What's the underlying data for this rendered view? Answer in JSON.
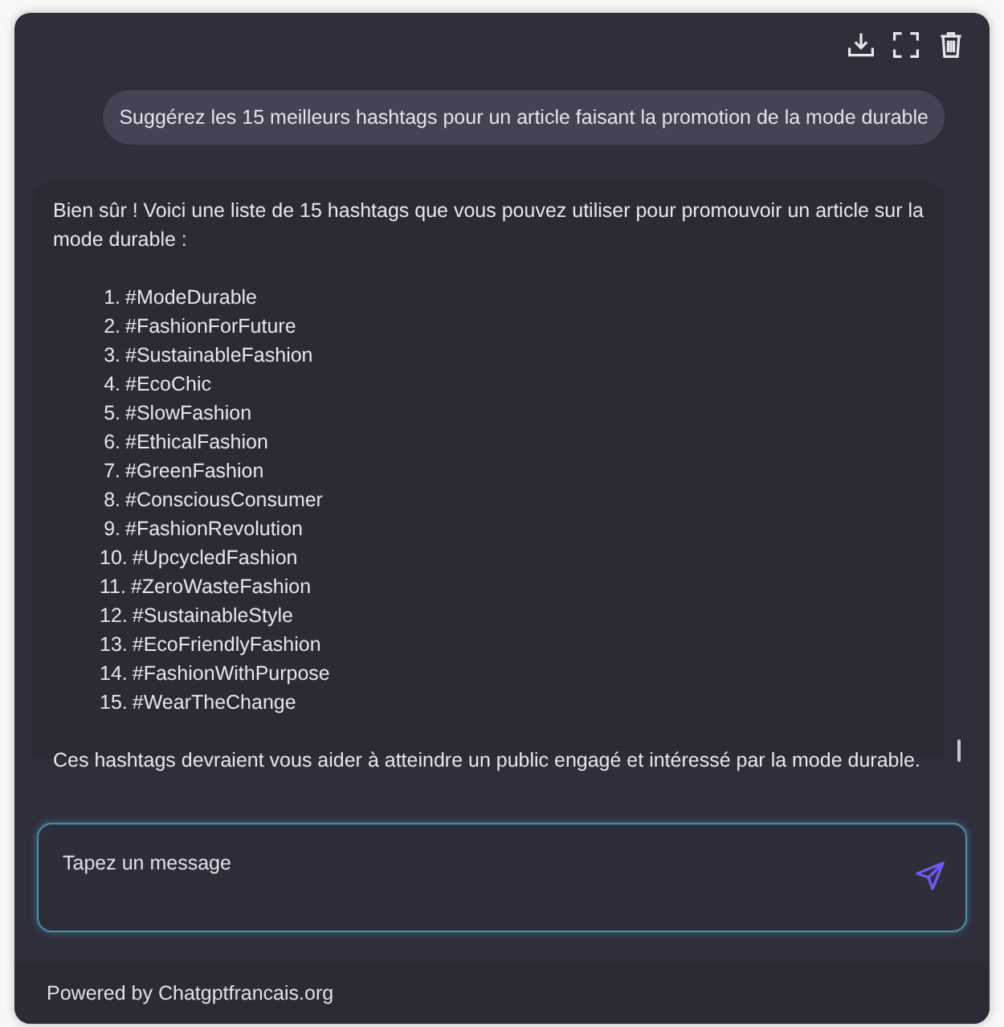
{
  "toolbar": {
    "buttons": [
      {
        "kind": "download"
      },
      {
        "kind": "fullscreen"
      },
      {
        "kind": "delete"
      }
    ]
  },
  "messages": [
    {
      "kind": "user",
      "text": "Suggérez les 15 meilleurs hashtags pour un article faisant la promotion de la mode durable"
    },
    {
      "kind": "assistant",
      "intro": "Bien sûr ! Voici une liste de 15 hashtags que vous pouvez utiliser pour promouvoir un article sur la mode durable :",
      "list": [
        {
          "number": "1.",
          "text": "#ModeDurable"
        },
        {
          "number": "2.",
          "text": "#FashionForFuture"
        },
        {
          "number": "3.",
          "text": "#SustainableFashion"
        },
        {
          "number": "4.",
          "text": "#EcoChic"
        },
        {
          "number": "5.",
          "text": "#SlowFashion"
        },
        {
          "number": "6.",
          "text": "#EthicalFashion"
        },
        {
          "number": "7.",
          "text": "#GreenFashion"
        },
        {
          "number": "8.",
          "text": "#ConsciousConsumer"
        },
        {
          "number": "9.",
          "text": "#FashionRevolution"
        },
        {
          "number": "10.",
          "text": "#UpcycledFashion"
        },
        {
          "number": "11.",
          "text": "#ZeroWasteFashion"
        },
        {
          "number": "12.",
          "text": "#SustainableStyle"
        },
        {
          "number": "13.",
          "text": "#EcoFriendlyFashion"
        },
        {
          "number": "14.",
          "text": "#FashionWithPurpose"
        },
        {
          "number": "15.",
          "text": "#WearTheChange"
        }
      ],
      "outro": "Ces hashtags devraient vous aider à atteindre un public engagé et intéressé par la mode durable."
    }
  ],
  "composer": {
    "placeholder": "Tapez un message"
  },
  "footer": "Powered by Chatgptfrancais.org"
}
